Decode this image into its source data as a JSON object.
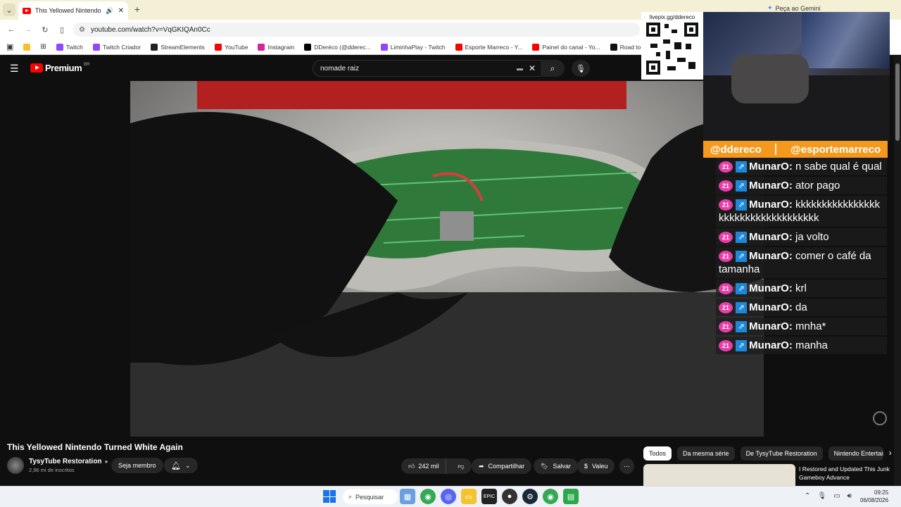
{
  "browser": {
    "tab_title": "This Yellowed Nintendo Tu",
    "url": "youtube.com/watch?v=VqGKIQAn0Cc",
    "gemini": "Peça ao Gemini",
    "bookmarks": [
      "Twitch",
      "Twitch Criador",
      "StreamElements",
      "YouTube",
      "Instagram",
      "DDeréco (@dderec...",
      "LiminhaPlay - Twitch",
      "Esporte Marreco - Y...",
      "Painel do canal - Yo...",
      "Road to Major - sim..."
    ]
  },
  "youtube": {
    "brand": "Premium",
    "region": "BR",
    "search_value": "nomade raiz"
  },
  "overlay": {
    "livepix": "livepix.gg/ddereco",
    "handle1": "@ddereco",
    "handle2": "@esportemarreco",
    "chat": [
      {
        "badge": "21",
        "user": "MunarO:",
        "text": "n sabe qual é qual"
      },
      {
        "badge": "21",
        "user": "MunarO:",
        "text": "ator pago"
      },
      {
        "badge": "21",
        "user": "MunarO:",
        "text": "kkkkkkkkkkkkkkkkkkkkkkkkkkkkkkkkkkk"
      },
      {
        "badge": "21",
        "user": "MunarO:",
        "text": "ja volto"
      },
      {
        "badge": "21",
        "user": "MunarO:",
        "text": "comer o café da tamanha"
      },
      {
        "badge": "21",
        "user": "MunarO:",
        "text": "krl"
      },
      {
        "badge": "21",
        "user": "MunarO:",
        "text": "da"
      },
      {
        "badge": "21",
        "user": "MunarO:",
        "text": "mnha*"
      },
      {
        "badge": "21",
        "user": "MunarO:",
        "text": "manha"
      }
    ]
  },
  "video": {
    "title": "This Yellowed Nintendo Turned White Again",
    "channel": "TysyTube Restoration",
    "subscribers": "2,96 mi de inscritos",
    "member_button": "Seja membro",
    "likes": "242 mil",
    "share": "Compartilhar",
    "save": "Salvar",
    "thanks": "Valeu"
  },
  "chips": [
    "Todos",
    "Da mesma série",
    "De TysyTube Restoration",
    "Nintendo Entertain"
  ],
  "recommendation": {
    "title": "I Restored and Updated This Junk Gameboy Advance"
  },
  "taskbar": {
    "search_label": "Pesquisar",
    "time": "09:25",
    "date": "06/08/2026"
  }
}
